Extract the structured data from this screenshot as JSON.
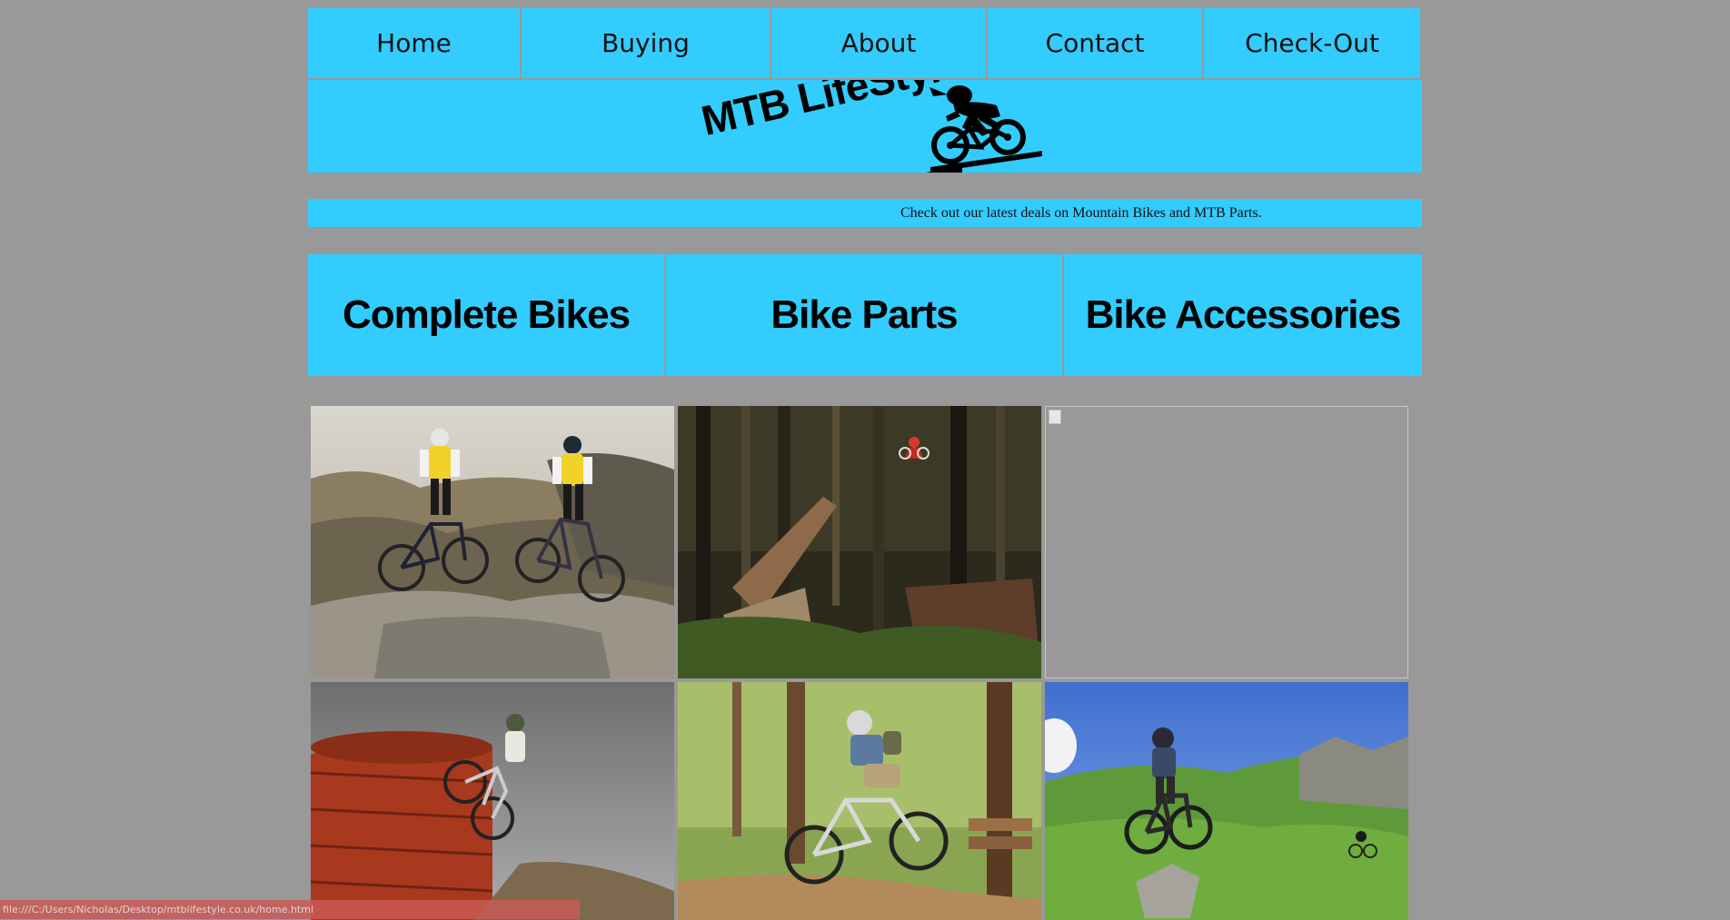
{
  "nav": {
    "items": [
      {
        "label": "Home"
      },
      {
        "label": "Buying"
      },
      {
        "label": "About"
      },
      {
        "label": "Contact"
      },
      {
        "label": "Check-Out"
      }
    ]
  },
  "banner": {
    "logo_text": "MTB LifeStyle",
    "logo_icon": "mountain-biker-icon"
  },
  "ticker": {
    "text": "Check out our latest deals on Mountain Bikes and MTB Parts."
  },
  "categories": [
    {
      "label": "Complete Bikes"
    },
    {
      "label": "Bike Parts"
    },
    {
      "label": "Bike Accessories"
    }
  ],
  "gallery": {
    "images": [
      {
        "name": "two-riders-jump-photo"
      },
      {
        "name": "forest-ramp-photo"
      },
      {
        "name": "broken-image"
      },
      {
        "name": "tank-wallride-photo"
      },
      {
        "name": "forest-trail-rider-photo"
      },
      {
        "name": "hillside-rider-photo"
      }
    ]
  },
  "status_bar": {
    "url": "file:///C:/Users/Nicholas/Desktop/mtblifestyle.co.uk/home.html"
  },
  "colors": {
    "background": "#999999",
    "accent": "#33ccff",
    "status_bar": "#c85a55"
  }
}
